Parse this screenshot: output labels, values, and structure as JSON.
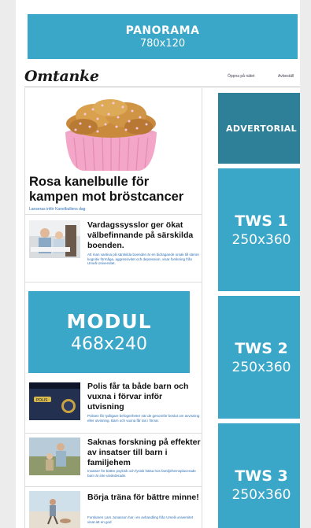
{
  "panorama": {
    "label": "PANORAMA",
    "size": "780x120"
  },
  "masthead": {
    "logo": "Omtanke",
    "links": [
      "Öppna på nätet",
      "Avbeställ"
    ]
  },
  "hero": {
    "title": "Rosa kanelbulle för kampen mot bröstcancer",
    "subtitle": "Lanseras inför Kanelbullens dag"
  },
  "articles": [
    {
      "title": "Vardagssysslor ger ökat välbefinnande på särskilda boenden.",
      "text": "Att man varitiva på särskilda boenden är en bidragande orsak till sämre kognitiv förmåga, aggressivitet och depression, visar forskning från Umeå Universitet."
    },
    {
      "title": "Polis får ta både barn och vuxna i förvar inför utvisning",
      "text": "Polisen får tydligare befogenheter när de genomför beslut om avvisning eller utvisning. Barn och vuxna får tas i förvar."
    },
    {
      "title": "Saknas forskning på effekter av insatser till barn i familjehem",
      "text": "Insatser för bättre psykisk och fysisk hälsa hos familjehemsplacerade barn är inte utvärderade."
    },
    {
      "title": "Börja träna för bättre minne!",
      "text": "Forskaren Lars Jonasson har i en avhandling från Umeå universitet visat att en god"
    }
  ],
  "modul": {
    "label": "MODUL",
    "size": "468x240"
  },
  "advertorial": {
    "label": "ADVERTORIAL"
  },
  "tws": [
    {
      "label": "TWS 1",
      "size": "250x360"
    },
    {
      "label": "TWS 2",
      "size": "250x360"
    },
    {
      "label": "TWS 3",
      "size": "250x360"
    }
  ],
  "colors": {
    "ad": "#3aa6c8",
    "advertorial": "#2e7f98",
    "link": "#2d6fb3"
  }
}
